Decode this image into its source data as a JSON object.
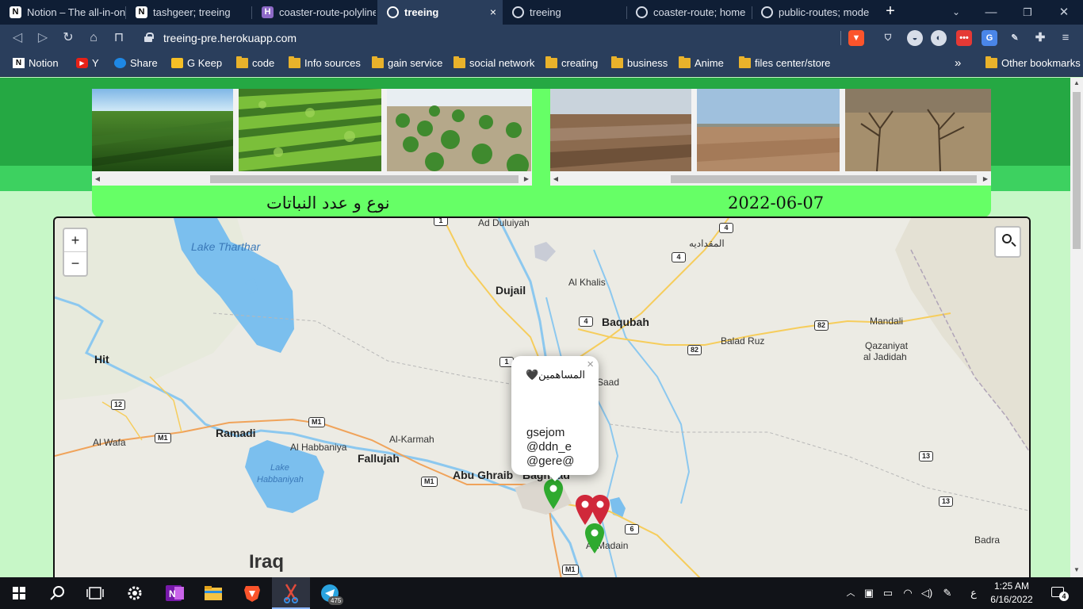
{
  "browser": {
    "tabs": [
      {
        "title": "Notion – The all-in-one",
        "icon": "notion-icon"
      },
      {
        "title": "tashgeer; treeing",
        "icon": "notion-icon"
      },
      {
        "title": "coaster-route-polyline",
        "icon": "heroku-icon"
      },
      {
        "title": "treeing",
        "icon": "globe-icon"
      },
      {
        "title": "treeing",
        "icon": "globe-icon"
      },
      {
        "title": "coaster-route; home",
        "icon": "globe-icon"
      },
      {
        "title": "public-routes; mode",
        "icon": "globe-icon"
      }
    ],
    "active_tab_index": 3,
    "close_symbol": "×",
    "new_tab_symbol": "+",
    "url": "treeing-pre.herokuapp.com",
    "bookmarks": [
      "Notion",
      "Y",
      "Share",
      "G Keep",
      "code",
      "Info sources",
      "gain service",
      "social network",
      "creating",
      "business",
      "Anime",
      "files center/store"
    ],
    "bookmarks_overflow": "»",
    "other_bookmarks": "Other bookmarks",
    "theme_color": "#2a3e5c"
  },
  "header": {
    "left_caption": "نوع و عدد النباتات",
    "right_caption": "2022-06-07",
    "accent_green": "#66ff66",
    "dark_green": "#25a843"
  },
  "map": {
    "zoom_in": "+",
    "zoom_out": "−",
    "labels": {
      "lake_tharthar": "Lake Tharthar",
      "ad_duluiyah": "Ad Duluiyah",
      "al_muqdadiya": "المقداديه",
      "dujail": "Dujail",
      "al_khalis": "Al Khalis",
      "baqubah": "Baqubah",
      "mandali": "Mandali",
      "balad_ruz": "Balad Ruz",
      "qazaniyat_1": "Qazaniyat",
      "qazaniyat_2": "al Jadidah",
      "hit": "Hit",
      "saad": "Saad",
      "ramadi": "Ramadi",
      "al_wafa": "Al Wafa",
      "al_karmah": "Al-Karmah",
      "al_habbaniya": "Al Habbaniya",
      "fallujah": "Fallujah",
      "lake_habbaniyah_1": "Lake",
      "lake_habbaniyah_2": "Habbaniyah",
      "abu_ghraib": "Abu Ghraib",
      "baghdad": "Baghdad",
      "al_madain": "Al Madain",
      "iraq": "Iraq",
      "badra": "Badra"
    },
    "shields": [
      "1",
      "4",
      "4",
      "4",
      "82",
      "82",
      "1",
      "12",
      "M1",
      "M1",
      "M1",
      "6",
      "13",
      "13",
      "M1"
    ],
    "popup": {
      "title": "المساهمين🖤",
      "lines": [
        "gsejom",
        "@ddn_e",
        "@gere@"
      ],
      "close": "×"
    },
    "marker_colors": {
      "green": "#2faa2f",
      "red": "#d0283a"
    }
  },
  "taskbar": {
    "apps": [
      "windows-start",
      "search",
      "task-view",
      "settings",
      "onenote",
      "file-explorer",
      "brave",
      "snipping-tool",
      "telegram"
    ],
    "telegram_badge": "475",
    "lang": "ع",
    "time": "1:25 AM",
    "date": "6/16/2022",
    "notifications": "4"
  }
}
